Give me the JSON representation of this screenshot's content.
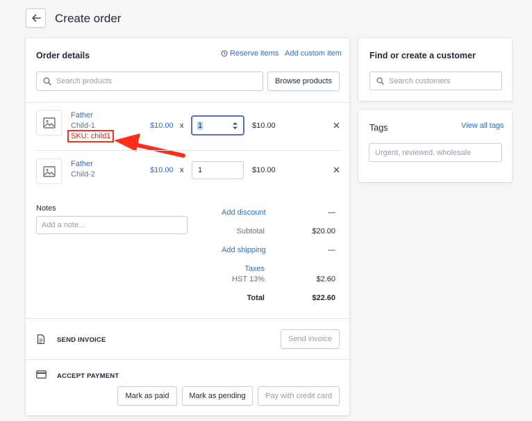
{
  "header": {
    "title": "Create order"
  },
  "order_details": {
    "title": "Order details",
    "reserve_label": "Reserve items",
    "add_custom_label": "Add custom item",
    "search_placeholder": "Search products",
    "browse_label": "Browse products",
    "items": [
      {
        "product": "Father",
        "variant": "Child-1",
        "sku": "SKU: child1",
        "price": "$10.00",
        "times": "x",
        "qty": "1",
        "total": "$10.00"
      },
      {
        "product": "Father",
        "variant": "Child-2",
        "price": "$10.00",
        "times": "x",
        "qty": "1",
        "total": "$10.00"
      }
    ]
  },
  "notes": {
    "label": "Notes",
    "placeholder": "Add a note..."
  },
  "summary": {
    "add_discount": "Add discount",
    "discount_value": "—",
    "subtotal_label": "Subtotal",
    "subtotal_value": "$20.00",
    "add_shipping": "Add shipping",
    "shipping_value": "—",
    "taxes_label": "Taxes",
    "tax_name": "HST 13%",
    "tax_value": "$2.60",
    "total_label": "Total",
    "total_value": "$22.60"
  },
  "invoice": {
    "title": "SEND INVOICE",
    "button": "Send invoice"
  },
  "payment": {
    "title": "ACCEPT PAYMENT",
    "mark_paid": "Mark as paid",
    "mark_pending": "Mark as pending",
    "pay_card": "Pay with credit card"
  },
  "customer": {
    "title": "Find or create a customer",
    "search_placeholder": "Search customers"
  },
  "tags": {
    "title": "Tags",
    "view_all": "View all tags",
    "placeholder": "Urgent, reviewed, wholesale"
  },
  "icons": [
    "back-arrow-icon",
    "clock-icon",
    "search-icon",
    "image-icon",
    "close-icon",
    "invoice-icon",
    "credit-card-icon",
    "stepper-icon"
  ],
  "colors": {
    "link": "#2c6ecb",
    "highlight": "#ff2d1a",
    "focus": "#5c6ac4"
  }
}
